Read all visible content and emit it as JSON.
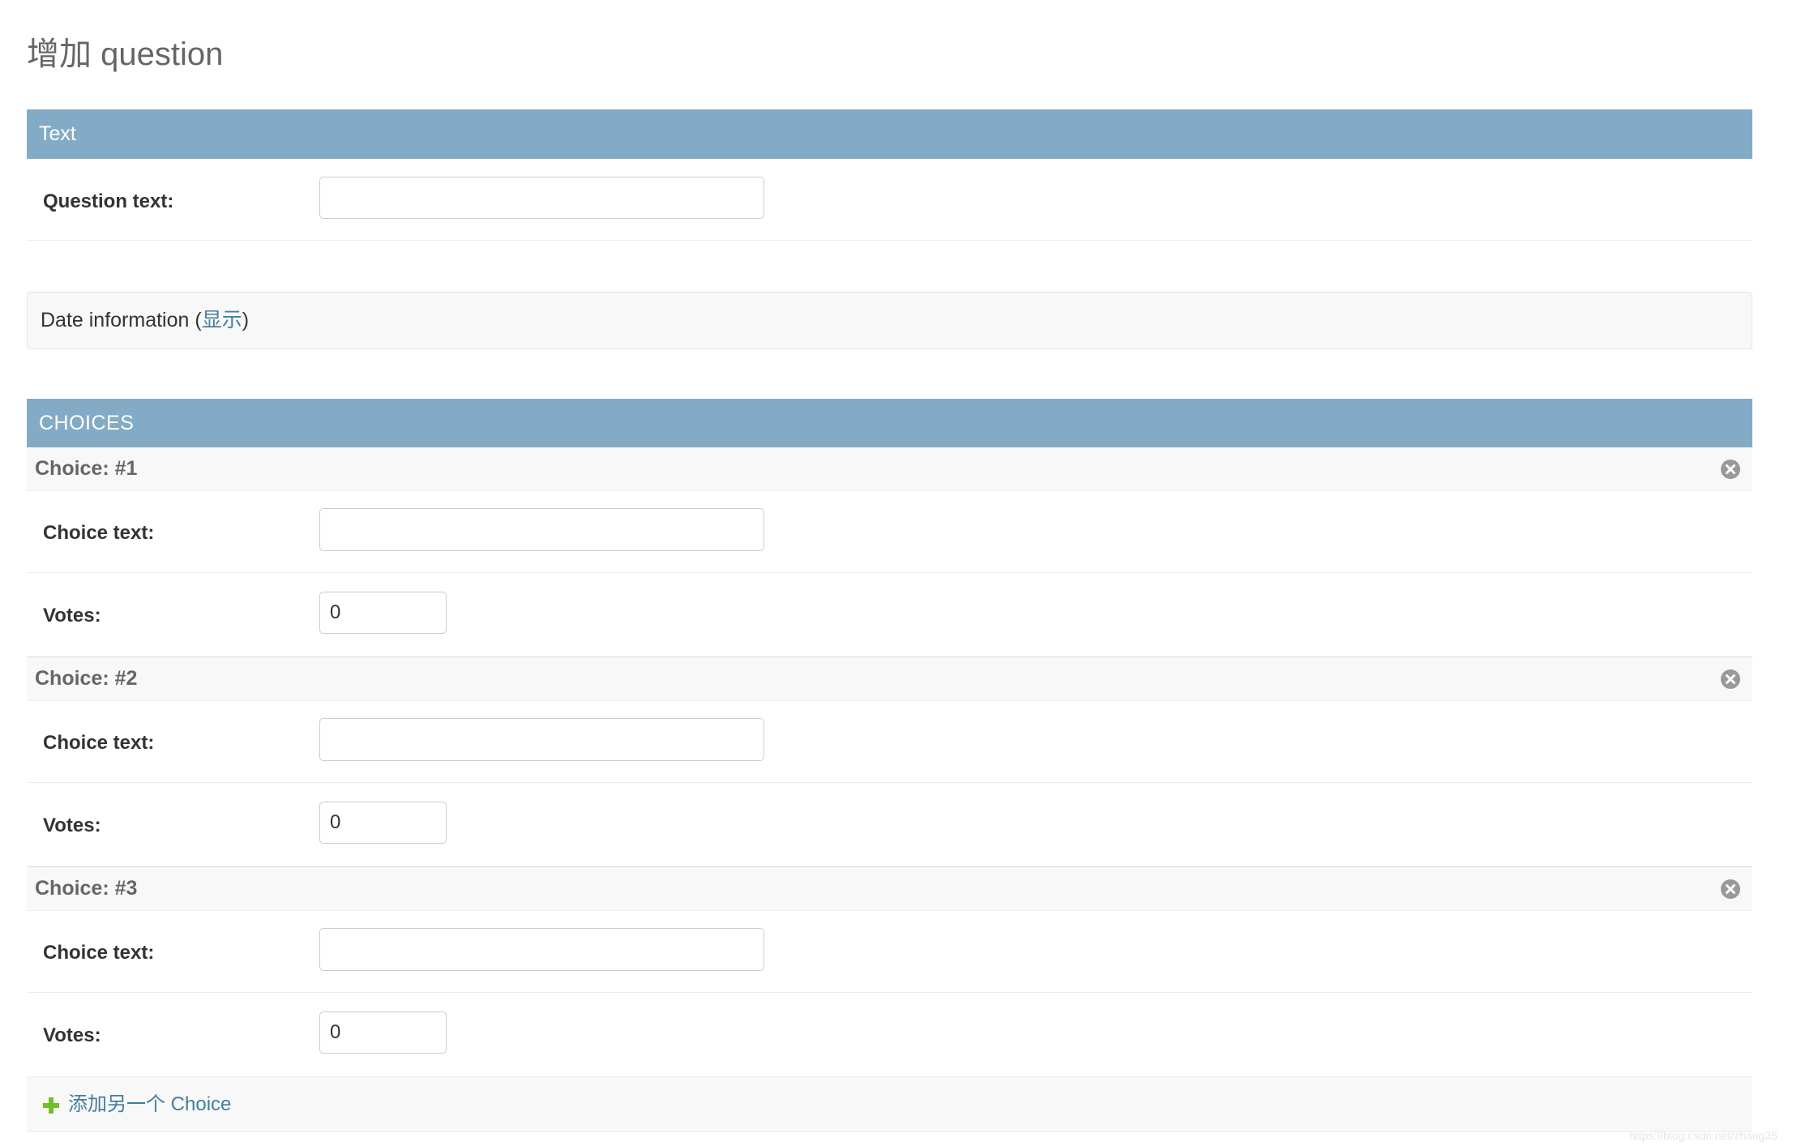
{
  "page": {
    "title": "增加 question"
  },
  "text_fieldset": {
    "header": "Text",
    "question_label": "Question text:",
    "question_value": ""
  },
  "date_fieldset": {
    "label": "Date information",
    "open_paren": " (",
    "toggle_link": "显示",
    "close_paren": ")"
  },
  "choices": {
    "header": "CHOICES",
    "items": [
      {
        "title": "Choice: #1",
        "choice_text_label": "Choice text:",
        "choice_text_value": "",
        "votes_label": "Votes:",
        "votes_value": "0",
        "remove_icon": "remove-circle-icon"
      },
      {
        "title": "Choice: #2",
        "choice_text_label": "Choice text:",
        "choice_text_value": "",
        "votes_label": "Votes:",
        "votes_value": "0",
        "remove_icon": "remove-circle-icon"
      },
      {
        "title": "Choice: #3",
        "choice_text_label": "Choice text:",
        "choice_text_value": "",
        "votes_label": "Votes:",
        "votes_value": "0",
        "remove_icon": "remove-circle-icon"
      }
    ]
  },
  "add_another": {
    "label": "添加另一个 Choice",
    "icon": "plus-icon"
  },
  "watermark": "https://blog.csdn.net/zhang35",
  "colors": {
    "caption_background": "#84abc6",
    "caption_text": "#ffffff",
    "link": "#447e9b",
    "add_icon": "#70bf2b",
    "remove_icon": "#999999",
    "inline_header_background": "#f8f8f8",
    "title_text": "#666666"
  }
}
